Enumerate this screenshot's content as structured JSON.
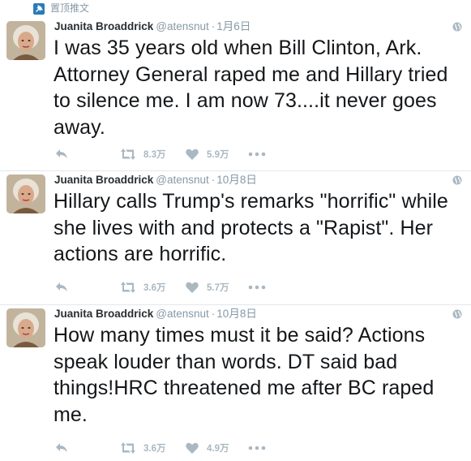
{
  "pinned": {
    "label": "置顶推文",
    "icon": "pin-icon"
  },
  "colors": {
    "meta": "#8899a6",
    "action": "#aab8c2",
    "text": "#14171a",
    "divider": "#e1e8ed"
  },
  "tweets": [
    {
      "name": "Juanita Broaddrick",
      "handle": "@atensnut",
      "separator": "·",
      "time": "1月6日",
      "text": "I was 35 years old when Bill Clinton, Ark. Attorney General raped me and Hillary tried to silence me.  I am now 73....it never goes away.",
      "retweets": "8.3万",
      "likes": "5.9万"
    },
    {
      "name": "Juanita Broaddrick",
      "handle": "@atensnut",
      "separator": "·",
      "time": "10月8日",
      "text": "Hillary calls Trump's remarks \"horrific\" while she lives with and protects a \"Rapist\".  Her actions are horrific.",
      "retweets": "3.6万",
      "likes": "5.7万"
    },
    {
      "name": "Juanita Broaddrick",
      "handle": "@atensnut",
      "separator": "·",
      "time": "10月8日",
      "text": "How many times must it be said? Actions speak louder than words. DT said bad things!HRC threatened me after BC raped me.",
      "retweets": "3.6万",
      "likes": "4.9万"
    }
  ]
}
